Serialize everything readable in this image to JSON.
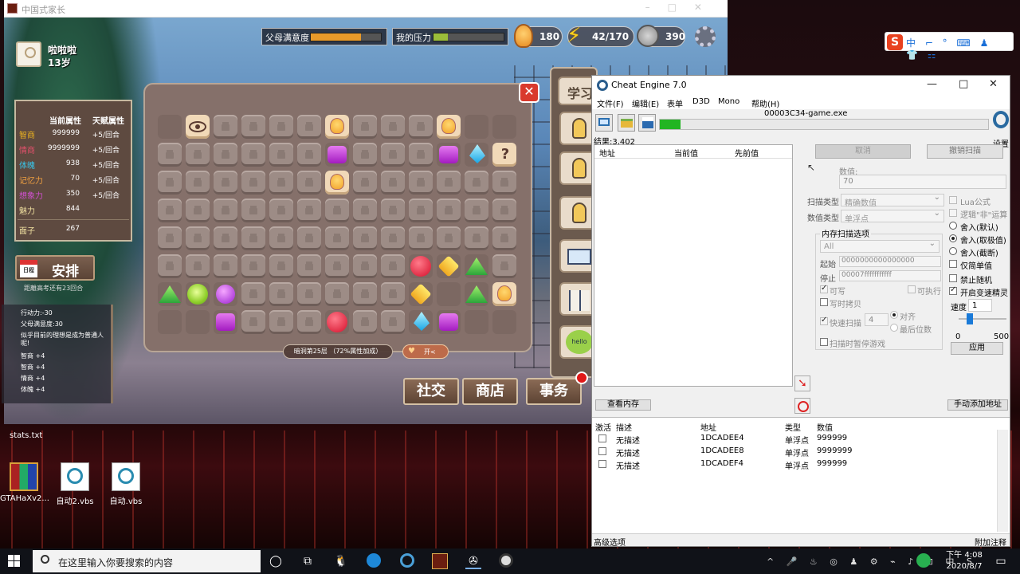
{
  "game_window": {
    "title": "中国式家长",
    "character": {
      "name": "啦啦啦",
      "age": "13岁"
    },
    "parent_satisfaction": {
      "label": "父母满意度",
      "level": 0.72
    },
    "my_pressure": {
      "label": "我的压力",
      "level": 0.2
    },
    "stats": {
      "ideas": "180",
      "energy": "42/170",
      "coins": "390"
    },
    "attributes": {
      "header_current": "当前属性",
      "header_talent": "天赋属性",
      "rows": [
        {
          "name": "智商",
          "value": "999999",
          "talent": "+5/回合",
          "color": "#e8b020"
        },
        {
          "name": "情商",
          "value": "9999999",
          "talent": "+5/回合",
          "color": "#e0506a"
        },
        {
          "name": "体魄",
          "value": "938",
          "talent": "+5/回合",
          "color": "#38c4e8"
        },
        {
          "name": "记忆力",
          "value": "70",
          "talent": "+5/回合",
          "color": "#f0a040"
        },
        {
          "name": "想象力",
          "value": "350",
          "talent": "+5/回合",
          "color": "#d050d0"
        },
        {
          "name": "魅力",
          "value": "844",
          "talent": "",
          "color": "#f0e0a0"
        }
      ],
      "face": {
        "name": "面子",
        "value": "267"
      }
    },
    "schedule_button": "安排",
    "calendar_label": "日程",
    "exam_note": "距離高考还有23回合",
    "log_lines": [
      "行动力:-30",
      "父母满意度:30",
      "似乎目前的理想是成为普通人呢!",
      "智商 +4",
      "智商 +4",
      "情商 +4",
      "体魄 +4"
    ],
    "board": {
      "rows": [
        [
          "empty",
          "eye",
          "lock",
          "lock",
          "lock",
          "lock",
          "bulb",
          "lock",
          "lock",
          "lock",
          "bulb",
          "empty",
          "empty"
        ],
        [
          "lock",
          "lock",
          "lock",
          "lock",
          "lock",
          "lock",
          "purple",
          "lock",
          "lock",
          "lock",
          "purple",
          "blue",
          "q"
        ],
        [
          "lock",
          "lock",
          "lock",
          "lock",
          "lock",
          "lock",
          "bulb",
          "lock",
          "lock",
          "lock",
          "lock",
          "lock",
          "lock"
        ],
        [
          "lock",
          "lock",
          "lock",
          "lock",
          "lock",
          "lock",
          "lock",
          "lock",
          "lock",
          "lock",
          "lock",
          "lock",
          "lock"
        ],
        [
          "lock",
          "lock",
          "lock",
          "lock",
          "lock",
          "lock",
          "lock",
          "lock",
          "lock",
          "lock",
          "lock",
          "lock",
          "lock"
        ],
        [
          "lock",
          "lock",
          "lock",
          "lock",
          "lock",
          "lock",
          "lock",
          "lock",
          "lock",
          "red",
          "yellow",
          "green",
          "lock"
        ],
        [
          "green",
          "lime",
          "violet",
          "lock",
          "lock",
          "lock",
          "lock",
          "lock",
          "lock",
          "yellow",
          "empty",
          "green",
          "bulb"
        ],
        [
          "empty",
          "empty",
          "purple",
          "lock",
          "lock",
          "lock",
          "red",
          "lock",
          "lock",
          "blue",
          "purple",
          "empty",
          "empty"
        ]
      ],
      "floor_label": "暗洞第25层 （72%属性加成）",
      "open_label": "开<"
    },
    "study_tab": "学习",
    "bottom_buttons": [
      "社交",
      "商店",
      "事务"
    ]
  },
  "desktop": {
    "stats_file": "stats.txt",
    "icons": [
      "GTAHaXv2...",
      "自动2.vbs",
      "自动.vbs"
    ]
  },
  "ime": {
    "brand": "S",
    "items": "中 ⌐ ° ⌨ ♟ 👕 ⚏"
  },
  "cheat_engine": {
    "title": "Cheat Engine 7.0",
    "menu": [
      "文件(F)",
      "编辑(E)",
      "表单",
      "D3D",
      "Mono",
      "帮助(H)"
    ],
    "process": "00003C34-game.exe",
    "settings_label": "设置",
    "results": "结果:3,402",
    "list_headers": [
      "地址",
      "当前值",
      "先前值"
    ],
    "cancel_btn": "取消",
    "undo_scan_btn": "撤销扫描",
    "value_label": "数值:",
    "value": "70",
    "scan_type_label": "扫描类型",
    "scan_type": "精确数值",
    "value_type_label": "数值类型",
    "value_type": "单浮点",
    "lua_formula": "Lua公式",
    "logic_not": "逻辑\"非\"运算",
    "round_default": "舍入(默认)",
    "round_trunc": "舍入(取极值)",
    "round_cut": "舍入(截断)",
    "simple_only": "仅简单值",
    "mem_options": "内存扫描选项",
    "mem_region": "All",
    "start_label": "起始",
    "start_value": "0000000000000000",
    "stop_label": "停止",
    "stop_value": "00007fffffffffff",
    "writable": "可写",
    "executable": "可执行",
    "copy_on_write": "写时拷贝",
    "fast_scan": "快速扫描",
    "fast_scan_value": "4",
    "align": "对齐",
    "last_digits": "最后位数",
    "pause_game": "扫描时暂停游戏",
    "disable_random": "禁止随机",
    "speedhack": "开启变速精灵",
    "speed_label": "速度",
    "speed_value": "1",
    "slider_min": "0",
    "slider_max": "500",
    "apply_btn": "应用",
    "view_memory_btn": "查看内存",
    "add_address_btn": "手动添加地址",
    "addr_headers": [
      "激活",
      "描述",
      "地址",
      "类型",
      "数值"
    ],
    "addr_rows": [
      {
        "desc": "无描述",
        "addr": "1DCADEE4",
        "type": "单浮点",
        "value": "999999"
      },
      {
        "desc": "无描述",
        "addr": "1DCADEE8",
        "type": "单浮点",
        "value": "9999999"
      },
      {
        "desc": "无描述",
        "addr": "1DCADEF4",
        "type": "单浮点",
        "value": "999999"
      }
    ],
    "advanced_options": "高级选项",
    "add_comment": "附加注释"
  },
  "taskbar": {
    "search_placeholder": "在这里输入你要搜索的内容",
    "time": "下午 4:08",
    "date": "2020/8/7"
  }
}
